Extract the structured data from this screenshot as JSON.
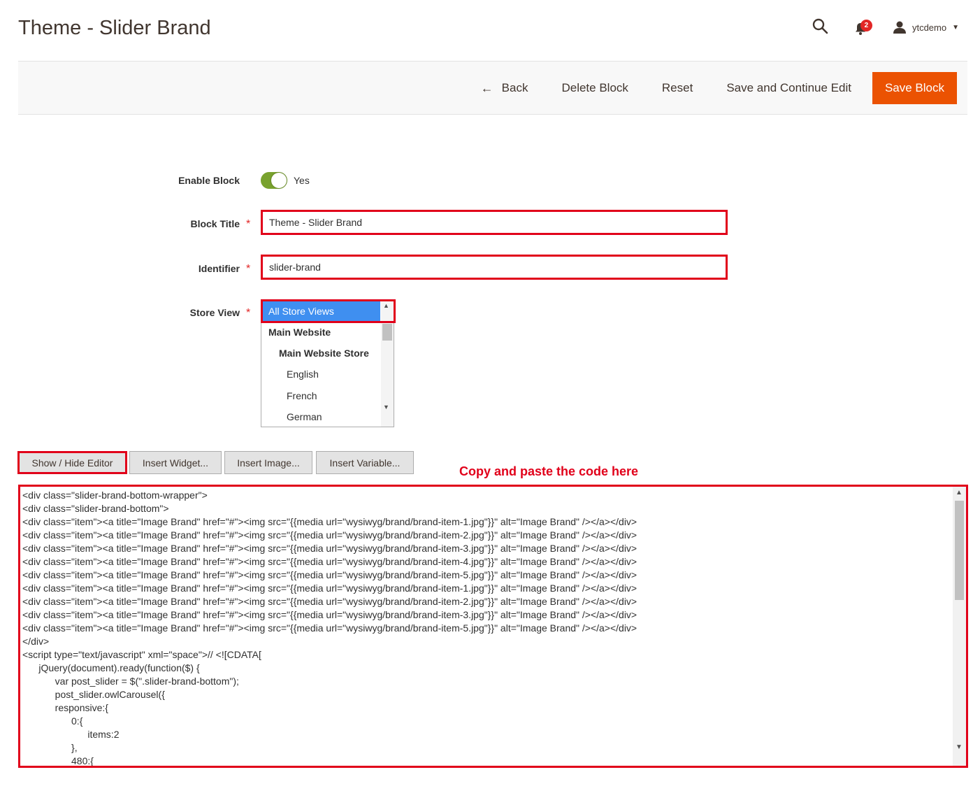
{
  "page": {
    "title": "Theme - Slider Brand"
  },
  "header": {
    "search_icon": "search-icon",
    "notifications": {
      "icon": "bell-icon",
      "count": "2"
    },
    "user": {
      "icon": "user-icon",
      "name": "ytcdemo",
      "caret": "▼"
    }
  },
  "actions": {
    "back": {
      "arrow": "←",
      "label": "Back"
    },
    "delete": "Delete Block",
    "reset": "Reset",
    "save_continue": "Save and Continue Edit",
    "save": "Save Block"
  },
  "form": {
    "enable": {
      "label": "Enable Block",
      "value": "Yes",
      "on": true
    },
    "title": {
      "label": "Block Title",
      "required": "*",
      "value": "Theme - Slider Brand"
    },
    "identifier": {
      "label": "Identifier",
      "required": "*",
      "value": "slider-brand"
    },
    "store_view": {
      "label": "Store View",
      "required": "*",
      "options": [
        "All Store Views",
        "Main Website",
        "Main Website Store",
        "English",
        "French",
        "German"
      ],
      "selected": "All Store Views"
    }
  },
  "editor_buttons": {
    "show_hide": "Show / Hide Editor",
    "widget": "Insert Widget...",
    "image": "Insert Image...",
    "variable": "Insert Variable..."
  },
  "annotation": "Copy and paste the code here",
  "code": "<div class=\"slider-brand-bottom-wrapper\">\n<div class=\"slider-brand-bottom\">\n<div class=\"item\"><a title=\"Image Brand\" href=\"#\"><img src=\"{{media url=\"wysiwyg/brand/brand-item-1.jpg\"}}\" alt=\"Image Brand\" /></a></div>\n<div class=\"item\"><a title=\"Image Brand\" href=\"#\"><img src=\"{{media url=\"wysiwyg/brand/brand-item-2.jpg\"}}\" alt=\"Image Brand\" /></a></div>\n<div class=\"item\"><a title=\"Image Brand\" href=\"#\"><img src=\"{{media url=\"wysiwyg/brand/brand-item-3.jpg\"}}\" alt=\"Image Brand\" /></a></div>\n<div class=\"item\"><a title=\"Image Brand\" href=\"#\"><img src=\"{{media url=\"wysiwyg/brand/brand-item-4.jpg\"}}\" alt=\"Image Brand\" /></a></div>\n<div class=\"item\"><a title=\"Image Brand\" href=\"#\"><img src=\"{{media url=\"wysiwyg/brand/brand-item-5.jpg\"}}\" alt=\"Image Brand\" /></a></div>\n<div class=\"item\"><a title=\"Image Brand\" href=\"#\"><img src=\"{{media url=\"wysiwyg/brand/brand-item-1.jpg\"}}\" alt=\"Image Brand\" /></a></div>\n<div class=\"item\"><a title=\"Image Brand\" href=\"#\"><img src=\"{{media url=\"wysiwyg/brand/brand-item-2.jpg\"}}\" alt=\"Image Brand\" /></a></div>\n<div class=\"item\"><a title=\"Image Brand\" href=\"#\"><img src=\"{{media url=\"wysiwyg/brand/brand-item-3.jpg\"}}\" alt=\"Image Brand\" /></a></div>\n<div class=\"item\"><a title=\"Image Brand\" href=\"#\"><img src=\"{{media url=\"wysiwyg/brand/brand-item-5.jpg\"}}\" alt=\"Image Brand\" /></a></div>\n</div>\n<script type=\"text/javascript\" xml=\"space\">// <![CDATA[\n      jQuery(document).ready(function($) {\n            var post_slider = $(\".slider-brand-bottom\");\n            post_slider.owlCarousel({\n            responsive:{\n                  0:{\n                        items:2\n                  },\n                  480:{",
  "colors": {
    "accent": "#eb5202",
    "highlight": "#e1001a",
    "toggle_on": "#79a22e",
    "selected_option": "#3f8ff0"
  }
}
